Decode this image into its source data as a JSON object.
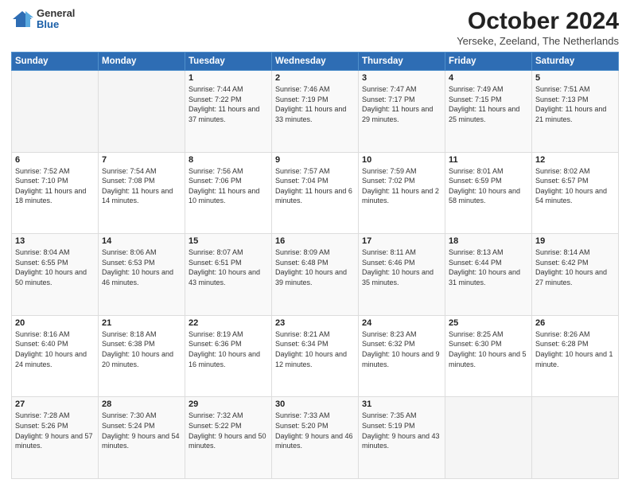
{
  "header": {
    "logo": {
      "general": "General",
      "blue": "Blue"
    },
    "title": "October 2024",
    "subtitle": "Yerseke, Zeeland, The Netherlands"
  },
  "weekdays": [
    "Sunday",
    "Monday",
    "Tuesday",
    "Wednesday",
    "Thursday",
    "Friday",
    "Saturday"
  ],
  "weeks": [
    [
      null,
      null,
      {
        "day": 1,
        "sunrise": "7:44 AM",
        "sunset": "7:22 PM",
        "daylight": "11 hours and 37 minutes."
      },
      {
        "day": 2,
        "sunrise": "7:46 AM",
        "sunset": "7:19 PM",
        "daylight": "11 hours and 33 minutes."
      },
      {
        "day": 3,
        "sunrise": "7:47 AM",
        "sunset": "7:17 PM",
        "daylight": "11 hours and 29 minutes."
      },
      {
        "day": 4,
        "sunrise": "7:49 AM",
        "sunset": "7:15 PM",
        "daylight": "11 hours and 25 minutes."
      },
      {
        "day": 5,
        "sunrise": "7:51 AM",
        "sunset": "7:13 PM",
        "daylight": "11 hours and 21 minutes."
      }
    ],
    [
      {
        "day": 6,
        "sunrise": "7:52 AM",
        "sunset": "7:10 PM",
        "daylight": "11 hours and 18 minutes."
      },
      {
        "day": 7,
        "sunrise": "7:54 AM",
        "sunset": "7:08 PM",
        "daylight": "11 hours and 14 minutes."
      },
      {
        "day": 8,
        "sunrise": "7:56 AM",
        "sunset": "7:06 PM",
        "daylight": "11 hours and 10 minutes."
      },
      {
        "day": 9,
        "sunrise": "7:57 AM",
        "sunset": "7:04 PM",
        "daylight": "11 hours and 6 minutes."
      },
      {
        "day": 10,
        "sunrise": "7:59 AM",
        "sunset": "7:02 PM",
        "daylight": "11 hours and 2 minutes."
      },
      {
        "day": 11,
        "sunrise": "8:01 AM",
        "sunset": "6:59 PM",
        "daylight": "10 hours and 58 minutes."
      },
      {
        "day": 12,
        "sunrise": "8:02 AM",
        "sunset": "6:57 PM",
        "daylight": "10 hours and 54 minutes."
      }
    ],
    [
      {
        "day": 13,
        "sunrise": "8:04 AM",
        "sunset": "6:55 PM",
        "daylight": "10 hours and 50 minutes."
      },
      {
        "day": 14,
        "sunrise": "8:06 AM",
        "sunset": "6:53 PM",
        "daylight": "10 hours and 46 minutes."
      },
      {
        "day": 15,
        "sunrise": "8:07 AM",
        "sunset": "6:51 PM",
        "daylight": "10 hours and 43 minutes."
      },
      {
        "day": 16,
        "sunrise": "8:09 AM",
        "sunset": "6:48 PM",
        "daylight": "10 hours and 39 minutes."
      },
      {
        "day": 17,
        "sunrise": "8:11 AM",
        "sunset": "6:46 PM",
        "daylight": "10 hours and 35 minutes."
      },
      {
        "day": 18,
        "sunrise": "8:13 AM",
        "sunset": "6:44 PM",
        "daylight": "10 hours and 31 minutes."
      },
      {
        "day": 19,
        "sunrise": "8:14 AM",
        "sunset": "6:42 PM",
        "daylight": "10 hours and 27 minutes."
      }
    ],
    [
      {
        "day": 20,
        "sunrise": "8:16 AM",
        "sunset": "6:40 PM",
        "daylight": "10 hours and 24 minutes."
      },
      {
        "day": 21,
        "sunrise": "8:18 AM",
        "sunset": "6:38 PM",
        "daylight": "10 hours and 20 minutes."
      },
      {
        "day": 22,
        "sunrise": "8:19 AM",
        "sunset": "6:36 PM",
        "daylight": "10 hours and 16 minutes."
      },
      {
        "day": 23,
        "sunrise": "8:21 AM",
        "sunset": "6:34 PM",
        "daylight": "10 hours and 12 minutes."
      },
      {
        "day": 24,
        "sunrise": "8:23 AM",
        "sunset": "6:32 PM",
        "daylight": "10 hours and 9 minutes."
      },
      {
        "day": 25,
        "sunrise": "8:25 AM",
        "sunset": "6:30 PM",
        "daylight": "10 hours and 5 minutes."
      },
      {
        "day": 26,
        "sunrise": "8:26 AM",
        "sunset": "6:28 PM",
        "daylight": "10 hours and 1 minute."
      }
    ],
    [
      {
        "day": 27,
        "sunrise": "7:28 AM",
        "sunset": "5:26 PM",
        "daylight": "9 hours and 57 minutes."
      },
      {
        "day": 28,
        "sunrise": "7:30 AM",
        "sunset": "5:24 PM",
        "daylight": "9 hours and 54 minutes."
      },
      {
        "day": 29,
        "sunrise": "7:32 AM",
        "sunset": "5:22 PM",
        "daylight": "9 hours and 50 minutes."
      },
      {
        "day": 30,
        "sunrise": "7:33 AM",
        "sunset": "5:20 PM",
        "daylight": "9 hours and 46 minutes."
      },
      {
        "day": 31,
        "sunrise": "7:35 AM",
        "sunset": "5:19 PM",
        "daylight": "9 hours and 43 minutes."
      },
      null,
      null
    ]
  ],
  "labels": {
    "sunrise_prefix": "Sunrise:",
    "sunset_prefix": "Sunset:",
    "daylight_prefix": "Daylight:"
  }
}
